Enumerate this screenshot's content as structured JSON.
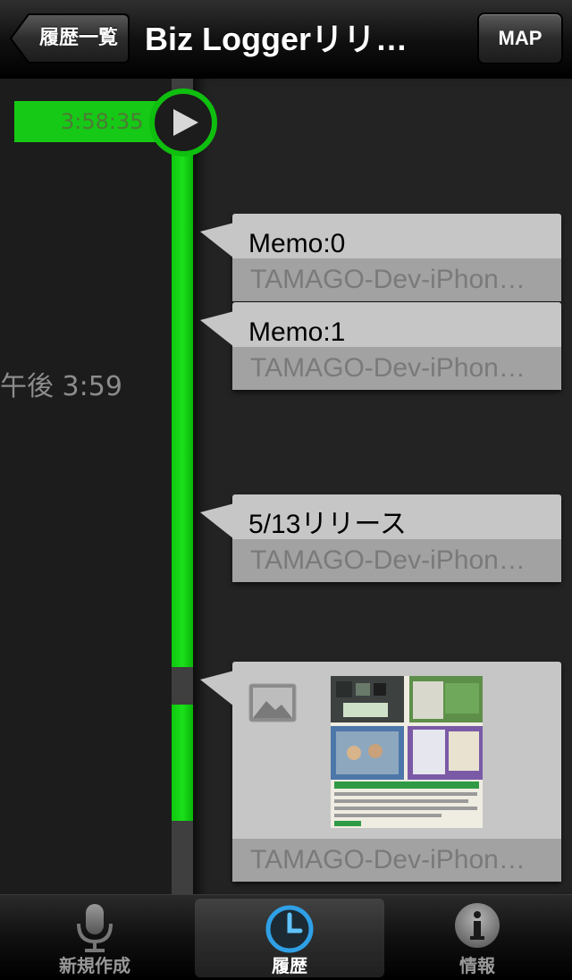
{
  "navbar": {
    "back_label": "履歴一覧",
    "title": "Biz Loggerリリ…",
    "map_label": "MAP"
  },
  "timeline": {
    "start_time": "3:58:35",
    "time_label": "午後 3:59",
    "items": [
      {
        "title": "Memo:0",
        "subtitle": "TAMAGO-Dev-iPhon…"
      },
      {
        "title": "Memo:1",
        "subtitle": "TAMAGO-Dev-iPhon…"
      },
      {
        "title": "5/13リリース",
        "subtitle": "TAMAGO-Dev-iPhon…"
      },
      {
        "type": "photo",
        "subtitle": "TAMAGO-Dev-iPhon…"
      }
    ]
  },
  "tabbar": {
    "tabs": [
      {
        "label": "新規作成",
        "icon": "microphone-icon"
      },
      {
        "label": "履歴",
        "icon": "clock-icon",
        "selected": true
      },
      {
        "label": "情報",
        "icon": "info-icon"
      }
    ]
  },
  "colors": {
    "accent_green": "#1bd81b",
    "card_bg": "#c6c6c6",
    "card_sub_bg": "#a2a2a2"
  }
}
